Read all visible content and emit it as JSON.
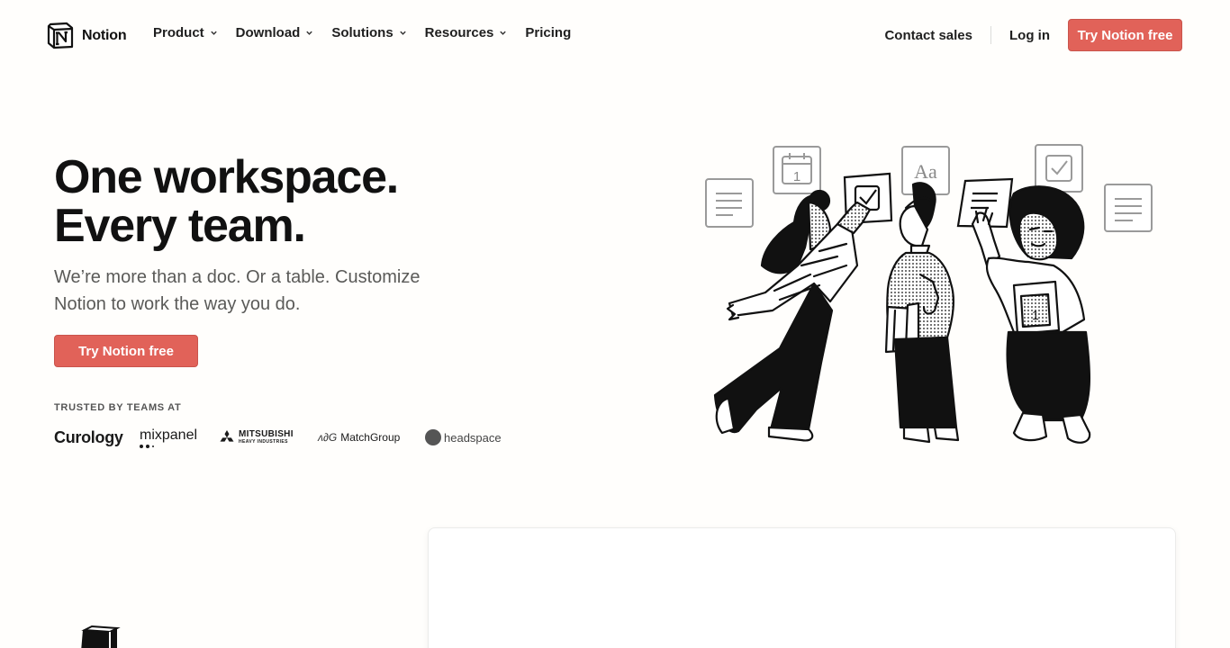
{
  "brand": {
    "name": "Notion",
    "accent": "#e16259"
  },
  "nav": {
    "items": [
      {
        "label": "Product",
        "has_dropdown": true
      },
      {
        "label": "Download",
        "has_dropdown": true
      },
      {
        "label": "Solutions",
        "has_dropdown": true
      },
      {
        "label": "Resources",
        "has_dropdown": true
      },
      {
        "label": "Pricing",
        "has_dropdown": false
      }
    ],
    "contact_sales": "Contact sales",
    "login": "Log in",
    "cta": "Try Notion free"
  },
  "hero": {
    "title_line1": "One workspace.",
    "title_line2": "Every team.",
    "subtitle": "We’re more than a doc. Or a table. Customize Notion to work the way you do.",
    "cta": "Try Notion free",
    "trusted_label": "TRUSTED BY TEAMS AT",
    "logos": {
      "curology": "Curology",
      "mixpanel": "mixpanel",
      "mitsubishi_line1": "MITSUBISHI",
      "mitsubishi_line2": "HEAVY INDUSTRIES",
      "matchgroup": "MatchGroup",
      "headspace": "headspace"
    }
  },
  "illustration": {
    "calendar_day": "1",
    "font_sample": "Aa"
  }
}
